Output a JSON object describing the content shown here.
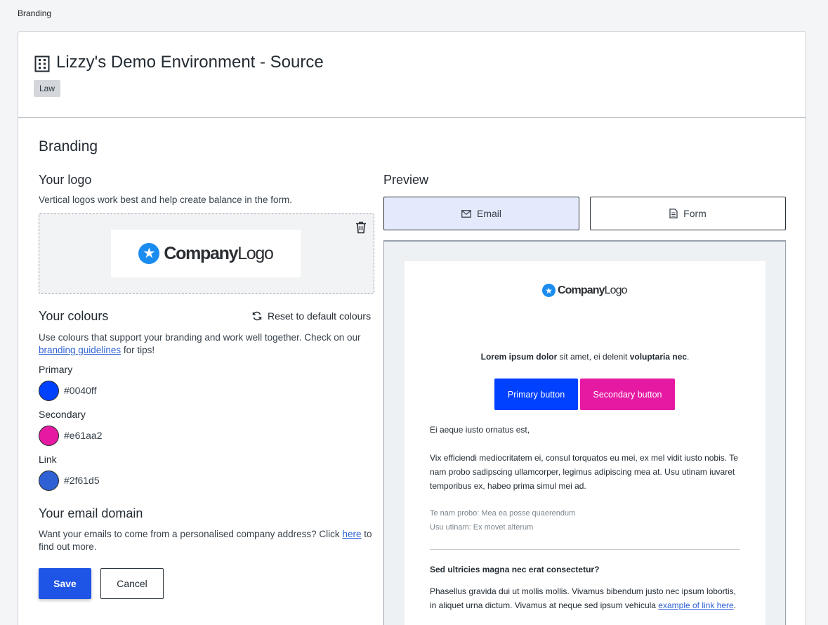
{
  "breadcrumb": "Branding",
  "org": {
    "title": "Lizzy's Demo Environment - Source",
    "tag": "Law"
  },
  "branding": {
    "heading": "Branding",
    "logo": {
      "heading": "Your logo",
      "hint": "Vertical logos work best and help create balance in the form.",
      "brand_bold": "Company",
      "brand_light": "Logo"
    },
    "colours": {
      "heading": "Your colours",
      "reset_label": "Reset to default colours",
      "desc_before": "Use colours that support your branding and work well together. Check on our ",
      "desc_link": "branding guidelines",
      "desc_after": " for tips!",
      "items": [
        {
          "label": "Primary",
          "hex": "#0040ff"
        },
        {
          "label": "Secondary",
          "hex": "#e61aa2"
        },
        {
          "label": "Link",
          "hex": "#2f61d5"
        }
      ]
    },
    "domain": {
      "heading": "Your email domain",
      "desc_before": "Want your emails to come from a personalised company address? Click ",
      "desc_link": "here",
      "desc_after": " to find out more."
    },
    "save_label": "Save",
    "cancel_label": "Cancel"
  },
  "preview": {
    "heading": "Preview",
    "tabs": [
      {
        "label": "Email",
        "icon": "mail-icon",
        "active": true
      },
      {
        "label": "Form",
        "icon": "document-icon",
        "active": false
      }
    ],
    "email": {
      "intro_bold1": "Lorem ipsum dolor",
      "intro_mid": " sit amet, ei delenit ",
      "intro_bold2": "voluptaria nec",
      "intro_end": ".",
      "primary_btn": "Primary button",
      "secondary_btn": "Secondary button",
      "greeting": "Ei aeque iusto ornatus est,",
      "body": "Vix efficiendi mediocritatem ei, consul torquatos eu mei, ex mel vidit iusto nobis. Te nam probo sadipscing ullamcorper, legimus adipiscing mea at. Usu utinam iuvaret temporibus ex, habeo prima simul mei ad.",
      "meta1": "Te nam probo: Mea ea posse quaerendum",
      "meta2": "Usu utinam: Ex movet alterum",
      "question": "Sed ultricies magna nec erat consectetur?",
      "answer_before": "Phasellus gravida dui ut mollis mollis. Vivamus bibendum justo nec ipsum lobortis, in aliquet urna dictum. Vivamus at neque sed ipsum vehicula ",
      "answer_link": "example of link here",
      "answer_after": "."
    }
  }
}
